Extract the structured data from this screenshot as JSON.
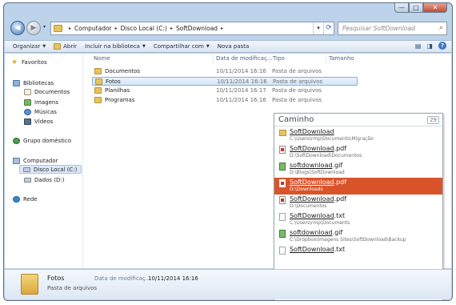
{
  "window": {
    "caption_buttons": {
      "minimize": "—",
      "maximize": "□",
      "close": "✕"
    }
  },
  "nav": {
    "back_icon": "◀",
    "forward_icon": "▶",
    "dropdown_icon": "▾",
    "breadcrumbs": [
      "Computador",
      "Disco Local (C:)",
      "SoftDownload"
    ],
    "crumb_separator": "▸",
    "refresh_icon": "⟳",
    "search_placeholder": "Pesquisar SoftDownload",
    "search_icon": "⌕"
  },
  "toolbar": {
    "organize": "Organizar",
    "open": "Abrir",
    "include": "Incluir na biblioteca",
    "share": "Compartilhar com",
    "new_folder": "Nova pasta",
    "dropdown_icon": "▼",
    "view_icon": "▤",
    "pane_icon": "◨",
    "help_icon": "?"
  },
  "sidebar": {
    "favorites": "Favoritos",
    "libraries": "Bibliotecas",
    "lib_items": [
      "Documentos",
      "Imagens",
      "Músicas",
      "Vídeos"
    ],
    "homegroup": "Grupo doméstico",
    "computer": "Computador",
    "drives": [
      "Disco Local (C:)",
      "Dados (D:)"
    ],
    "network": "Rede",
    "star_icon": "★"
  },
  "filelist": {
    "columns": [
      "Nome",
      "Data de modificaç...",
      "Tipo",
      "Tamanho"
    ],
    "rows": [
      {
        "name": "Documentos",
        "date": "10/11/2014 16:16",
        "type": "Pasta de arquivos"
      },
      {
        "name": "Fotos",
        "date": "10/11/2014 16:16",
        "type": "Pasta de arquivos"
      },
      {
        "name": "Planilhas",
        "date": "10/11/2014 16:17",
        "type": "Pasta de arquivos"
      },
      {
        "name": "Programas",
        "date": "10/11/2014 16:16",
        "type": "Pasta de arquivos"
      }
    ]
  },
  "popup": {
    "title": "Caminho",
    "count": "29",
    "results": [
      {
        "name": "SoftDownload",
        "ext": "",
        "path": "C:\\Users\\rmp\\Documents\\Migração",
        "icon": "folder"
      },
      {
        "name": "SoftDownload",
        "ext": ".pdf",
        "path": "D:\\SoftDownload\\Documentos",
        "icon": "pdf"
      },
      {
        "name": "softdownload",
        "ext": ".gif",
        "path": "D:\\Blogs\\SoftDownload",
        "icon": "gif"
      },
      {
        "name": "SoftDownload",
        "ext": ".pdf",
        "path": "D:\\Downloads",
        "icon": "pdf"
      },
      {
        "name": "SoftDownload",
        "ext": ".pdf",
        "path": "D:\\Documentos",
        "icon": "pdf"
      },
      {
        "name": "SoftDownload",
        "ext": ".txt",
        "path": "C:\\Users\\rmp\\Documents",
        "icon": "txt"
      },
      {
        "name": "softdownload",
        "ext": ".gif",
        "path": "C:\\Dropbox\\Imagens Sites\\SoftDownload\\Backup",
        "icon": "gif"
      },
      {
        "name": "SoftDownload",
        "ext": ".txt",
        "path": "",
        "icon": "txt"
      }
    ],
    "active_index": 3,
    "query": "softdownload",
    "icons": {
      "a": "✎",
      "b": "⚙",
      "c": "⚡"
    }
  },
  "details": {
    "name": "Fotos",
    "type": "Pasta de arquivos",
    "date_label": "Data de modificaç...",
    "date_value": "10/11/2014 16:16"
  }
}
